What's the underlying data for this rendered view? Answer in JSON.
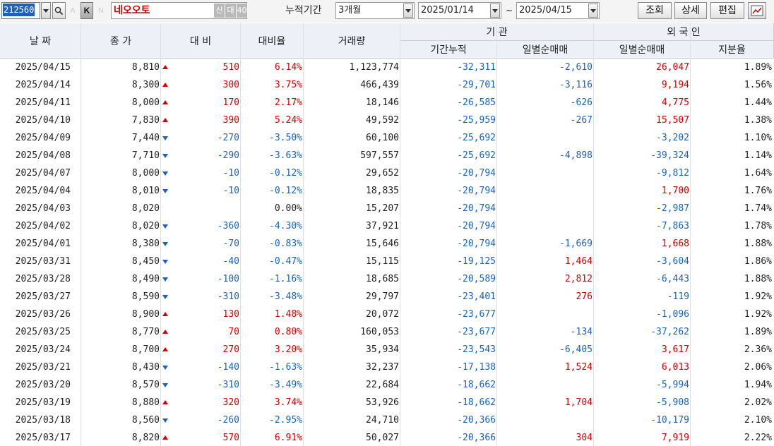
{
  "toolbar": {
    "stock_code": "212560",
    "stock_name": "네오오토",
    "k_label": "K",
    "a_label": "A",
    "n_label": "N",
    "tag_new": "신",
    "tag_loan": "대",
    "tag_margin": "40",
    "period_label": "누적기간",
    "period_value": "3개월",
    "date_from": "2025/01/14",
    "tilde": "~",
    "date_to": "2025/04/15",
    "query_button": "조회",
    "detail_button": "상세",
    "edit_button": "편집",
    "chart_icon": "chart-icon"
  },
  "header": {
    "date": "날 짜",
    "close": "종 가",
    "change": "대 비",
    "change_rate": "대비율",
    "volume": "거래량",
    "institution": "기  관",
    "inst_cum": "기간누적",
    "inst_daily": "일별순매매",
    "foreign": "외 국 인",
    "frgn_daily": "일별순매매",
    "frgn_ratio": "지분율"
  },
  "colors": {
    "up": "#d40000",
    "down": "#1a63b8"
  },
  "rows": [
    {
      "date": "2025/04/15",
      "close": "8,810",
      "dir": "up",
      "change": "510",
      "rate": "6.14%",
      "volume": "1,123,774",
      "inst_cum": "-32,311",
      "inst_daily": "-2,610",
      "frgn": "26,047",
      "ratio": "1.89%"
    },
    {
      "date": "2025/04/14",
      "close": "8,300",
      "dir": "up",
      "change": "300",
      "rate": "3.75%",
      "volume": "466,439",
      "inst_cum": "-29,701",
      "inst_daily": "-3,116",
      "frgn": "9,194",
      "ratio": "1.56%"
    },
    {
      "date": "2025/04/11",
      "close": "8,000",
      "dir": "up",
      "change": "170",
      "rate": "2.17%",
      "volume": "18,146",
      "inst_cum": "-26,585",
      "inst_daily": "-626",
      "frgn": "4,775",
      "ratio": "1.44%"
    },
    {
      "date": "2025/04/10",
      "close": "7,830",
      "dir": "up",
      "change": "390",
      "rate": "5.24%",
      "volume": "49,592",
      "inst_cum": "-25,959",
      "inst_daily": "-267",
      "frgn": "15,507",
      "ratio": "1.38%"
    },
    {
      "date": "2025/04/09",
      "close": "7,440",
      "dir": "down",
      "change": "-270",
      "rate": "-3.50%",
      "volume": "60,100",
      "inst_cum": "-25,692",
      "inst_daily": "",
      "frgn": "-3,202",
      "ratio": "1.10%"
    },
    {
      "date": "2025/04/08",
      "close": "7,710",
      "dir": "down",
      "change": "-290",
      "rate": "-3.63%",
      "volume": "597,557",
      "inst_cum": "-25,692",
      "inst_daily": "-4,898",
      "frgn": "-39,324",
      "ratio": "1.14%"
    },
    {
      "date": "2025/04/07",
      "close": "8,000",
      "dir": "down",
      "change": "-10",
      "rate": "-0.12%",
      "volume": "29,652",
      "inst_cum": "-20,794",
      "inst_daily": "",
      "frgn": "-9,812",
      "ratio": "1.64%"
    },
    {
      "date": "2025/04/04",
      "close": "8,010",
      "dir": "down",
      "change": "-10",
      "rate": "-0.12%",
      "volume": "18,835",
      "inst_cum": "-20,794",
      "inst_daily": "",
      "frgn": "1,700",
      "ratio": "1.76%"
    },
    {
      "date": "2025/04/03",
      "close": "8,020",
      "dir": "none",
      "change": "",
      "rate": "0.00%",
      "volume": "15,207",
      "inst_cum": "-20,794",
      "inst_daily": "",
      "frgn": "-2,987",
      "ratio": "1.74%"
    },
    {
      "date": "2025/04/02",
      "close": "8,020",
      "dir": "down",
      "change": "-360",
      "rate": "-4.30%",
      "volume": "37,921",
      "inst_cum": "-20,794",
      "inst_daily": "",
      "frgn": "-7,863",
      "ratio": "1.78%"
    },
    {
      "date": "2025/04/01",
      "close": "8,380",
      "dir": "down",
      "change": "-70",
      "rate": "-0.83%",
      "volume": "15,646",
      "inst_cum": "-20,794",
      "inst_daily": "-1,669",
      "frgn": "1,668",
      "ratio": "1.88%"
    },
    {
      "date": "2025/03/31",
      "close": "8,450",
      "dir": "down",
      "change": "-40",
      "rate": "-0.47%",
      "volume": "15,115",
      "inst_cum": "-19,125",
      "inst_daily": "1,464",
      "frgn": "-3,604",
      "ratio": "1.86%"
    },
    {
      "date": "2025/03/28",
      "close": "8,490",
      "dir": "down",
      "change": "-100",
      "rate": "-1.16%",
      "volume": "18,685",
      "inst_cum": "-20,589",
      "inst_daily": "2,812",
      "frgn": "-6,443",
      "ratio": "1.88%"
    },
    {
      "date": "2025/03/27",
      "close": "8,590",
      "dir": "down",
      "change": "-310",
      "rate": "-3.48%",
      "volume": "29,797",
      "inst_cum": "-23,401",
      "inst_daily": "276",
      "frgn": "-119",
      "ratio": "1.92%"
    },
    {
      "date": "2025/03/26",
      "close": "8,900",
      "dir": "up",
      "change": "130",
      "rate": "1.48%",
      "volume": "20,072",
      "inst_cum": "-23,677",
      "inst_daily": "",
      "frgn": "-1,096",
      "ratio": "1.92%"
    },
    {
      "date": "2025/03/25",
      "close": "8,770",
      "dir": "up",
      "change": "70",
      "rate": "0.80%",
      "volume": "160,053",
      "inst_cum": "-23,677",
      "inst_daily": "-134",
      "frgn": "-37,262",
      "ratio": "1.89%"
    },
    {
      "date": "2025/03/24",
      "close": "8,700",
      "dir": "up",
      "change": "270",
      "rate": "3.20%",
      "volume": "35,934",
      "inst_cum": "-23,543",
      "inst_daily": "-6,405",
      "frgn": "3,617",
      "ratio": "2.36%"
    },
    {
      "date": "2025/03/21",
      "close": "8,430",
      "dir": "down",
      "change": "-140",
      "rate": "-1.63%",
      "volume": "32,237",
      "inst_cum": "-17,138",
      "inst_daily": "1,524",
      "frgn": "6,013",
      "ratio": "2.06%"
    },
    {
      "date": "2025/03/20",
      "close": "8,570",
      "dir": "down",
      "change": "-310",
      "rate": "-3.49%",
      "volume": "22,684",
      "inst_cum": "-18,662",
      "inst_daily": "",
      "frgn": "-5,994",
      "ratio": "1.94%"
    },
    {
      "date": "2025/03/19",
      "close": "8,880",
      "dir": "up",
      "change": "320",
      "rate": "3.74%",
      "volume": "53,926",
      "inst_cum": "-18,662",
      "inst_daily": "1,704",
      "frgn": "-5,908",
      "ratio": "2.02%"
    },
    {
      "date": "2025/03/18",
      "close": "8,560",
      "dir": "down",
      "change": "-260",
      "rate": "-2.95%",
      "volume": "24,710",
      "inst_cum": "-20,366",
      "inst_daily": "",
      "frgn": "-10,179",
      "ratio": "2.10%"
    },
    {
      "date": "2025/03/17",
      "close": "8,820",
      "dir": "up",
      "change": "570",
      "rate": "6.91%",
      "volume": "50,027",
      "inst_cum": "-20,366",
      "inst_daily": "304",
      "frgn": "7,919",
      "ratio": "2.22%"
    }
  ]
}
